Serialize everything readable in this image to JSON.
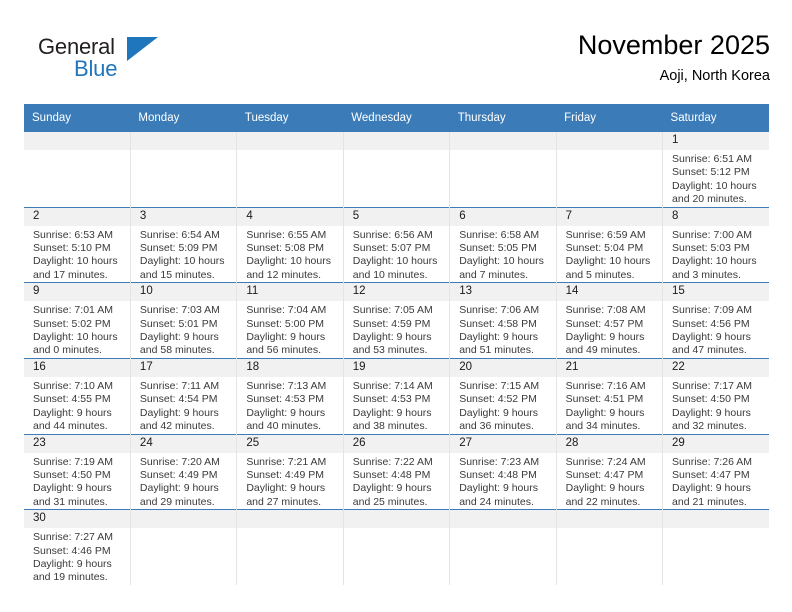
{
  "brand": {
    "name_top": "General",
    "name_bottom": "Blue",
    "accent_color": "#1f76bc",
    "flag_icon": "triangle-flag-icon"
  },
  "header": {
    "title": "November 2025",
    "subtitle": "Aoji, North Korea"
  },
  "theme": {
    "header_bg": "#3b7cb8",
    "daynum_bg": "#f1f1f1",
    "row_divider": "#3b7cb8",
    "col_divider": "#e4e4e4",
    "text": "#3a3a3a"
  },
  "weekdays": [
    "Sunday",
    "Monday",
    "Tuesday",
    "Wednesday",
    "Thursday",
    "Friday",
    "Saturday"
  ],
  "weeks": [
    [
      {
        "day": "",
        "sunrise": "",
        "sunset": "",
        "daylight_1": "",
        "daylight_2": ""
      },
      {
        "day": "",
        "sunrise": "",
        "sunset": "",
        "daylight_1": "",
        "daylight_2": ""
      },
      {
        "day": "",
        "sunrise": "",
        "sunset": "",
        "daylight_1": "",
        "daylight_2": ""
      },
      {
        "day": "",
        "sunrise": "",
        "sunset": "",
        "daylight_1": "",
        "daylight_2": ""
      },
      {
        "day": "",
        "sunrise": "",
        "sunset": "",
        "daylight_1": "",
        "daylight_2": ""
      },
      {
        "day": "",
        "sunrise": "",
        "sunset": "",
        "daylight_1": "",
        "daylight_2": ""
      },
      {
        "day": "1",
        "sunrise": "Sunrise: 6:51 AM",
        "sunset": "Sunset: 5:12 PM",
        "daylight_1": "Daylight: 10 hours",
        "daylight_2": "and 20 minutes."
      }
    ],
    [
      {
        "day": "2",
        "sunrise": "Sunrise: 6:53 AM",
        "sunset": "Sunset: 5:10 PM",
        "daylight_1": "Daylight: 10 hours",
        "daylight_2": "and 17 minutes."
      },
      {
        "day": "3",
        "sunrise": "Sunrise: 6:54 AM",
        "sunset": "Sunset: 5:09 PM",
        "daylight_1": "Daylight: 10 hours",
        "daylight_2": "and 15 minutes."
      },
      {
        "day": "4",
        "sunrise": "Sunrise: 6:55 AM",
        "sunset": "Sunset: 5:08 PM",
        "daylight_1": "Daylight: 10 hours",
        "daylight_2": "and 12 minutes."
      },
      {
        "day": "5",
        "sunrise": "Sunrise: 6:56 AM",
        "sunset": "Sunset: 5:07 PM",
        "daylight_1": "Daylight: 10 hours",
        "daylight_2": "and 10 minutes."
      },
      {
        "day": "6",
        "sunrise": "Sunrise: 6:58 AM",
        "sunset": "Sunset: 5:05 PM",
        "daylight_1": "Daylight: 10 hours",
        "daylight_2": "and 7 minutes."
      },
      {
        "day": "7",
        "sunrise": "Sunrise: 6:59 AM",
        "sunset": "Sunset: 5:04 PM",
        "daylight_1": "Daylight: 10 hours",
        "daylight_2": "and 5 minutes."
      },
      {
        "day": "8",
        "sunrise": "Sunrise: 7:00 AM",
        "sunset": "Sunset: 5:03 PM",
        "daylight_1": "Daylight: 10 hours",
        "daylight_2": "and 3 minutes."
      }
    ],
    [
      {
        "day": "9",
        "sunrise": "Sunrise: 7:01 AM",
        "sunset": "Sunset: 5:02 PM",
        "daylight_1": "Daylight: 10 hours",
        "daylight_2": "and 0 minutes."
      },
      {
        "day": "10",
        "sunrise": "Sunrise: 7:03 AM",
        "sunset": "Sunset: 5:01 PM",
        "daylight_1": "Daylight: 9 hours",
        "daylight_2": "and 58 minutes."
      },
      {
        "day": "11",
        "sunrise": "Sunrise: 7:04 AM",
        "sunset": "Sunset: 5:00 PM",
        "daylight_1": "Daylight: 9 hours",
        "daylight_2": "and 56 minutes."
      },
      {
        "day": "12",
        "sunrise": "Sunrise: 7:05 AM",
        "sunset": "Sunset: 4:59 PM",
        "daylight_1": "Daylight: 9 hours",
        "daylight_2": "and 53 minutes."
      },
      {
        "day": "13",
        "sunrise": "Sunrise: 7:06 AM",
        "sunset": "Sunset: 4:58 PM",
        "daylight_1": "Daylight: 9 hours",
        "daylight_2": "and 51 minutes."
      },
      {
        "day": "14",
        "sunrise": "Sunrise: 7:08 AM",
        "sunset": "Sunset: 4:57 PM",
        "daylight_1": "Daylight: 9 hours",
        "daylight_2": "and 49 minutes."
      },
      {
        "day": "15",
        "sunrise": "Sunrise: 7:09 AM",
        "sunset": "Sunset: 4:56 PM",
        "daylight_1": "Daylight: 9 hours",
        "daylight_2": "and 47 minutes."
      }
    ],
    [
      {
        "day": "16",
        "sunrise": "Sunrise: 7:10 AM",
        "sunset": "Sunset: 4:55 PM",
        "daylight_1": "Daylight: 9 hours",
        "daylight_2": "and 44 minutes."
      },
      {
        "day": "17",
        "sunrise": "Sunrise: 7:11 AM",
        "sunset": "Sunset: 4:54 PM",
        "daylight_1": "Daylight: 9 hours",
        "daylight_2": "and 42 minutes."
      },
      {
        "day": "18",
        "sunrise": "Sunrise: 7:13 AM",
        "sunset": "Sunset: 4:53 PM",
        "daylight_1": "Daylight: 9 hours",
        "daylight_2": "and 40 minutes."
      },
      {
        "day": "19",
        "sunrise": "Sunrise: 7:14 AM",
        "sunset": "Sunset: 4:53 PM",
        "daylight_1": "Daylight: 9 hours",
        "daylight_2": "and 38 minutes."
      },
      {
        "day": "20",
        "sunrise": "Sunrise: 7:15 AM",
        "sunset": "Sunset: 4:52 PM",
        "daylight_1": "Daylight: 9 hours",
        "daylight_2": "and 36 minutes."
      },
      {
        "day": "21",
        "sunrise": "Sunrise: 7:16 AM",
        "sunset": "Sunset: 4:51 PM",
        "daylight_1": "Daylight: 9 hours",
        "daylight_2": "and 34 minutes."
      },
      {
        "day": "22",
        "sunrise": "Sunrise: 7:17 AM",
        "sunset": "Sunset: 4:50 PM",
        "daylight_1": "Daylight: 9 hours",
        "daylight_2": "and 32 minutes."
      }
    ],
    [
      {
        "day": "23",
        "sunrise": "Sunrise: 7:19 AM",
        "sunset": "Sunset: 4:50 PM",
        "daylight_1": "Daylight: 9 hours",
        "daylight_2": "and 31 minutes."
      },
      {
        "day": "24",
        "sunrise": "Sunrise: 7:20 AM",
        "sunset": "Sunset: 4:49 PM",
        "daylight_1": "Daylight: 9 hours",
        "daylight_2": "and 29 minutes."
      },
      {
        "day": "25",
        "sunrise": "Sunrise: 7:21 AM",
        "sunset": "Sunset: 4:49 PM",
        "daylight_1": "Daylight: 9 hours",
        "daylight_2": "and 27 minutes."
      },
      {
        "day": "26",
        "sunrise": "Sunrise: 7:22 AM",
        "sunset": "Sunset: 4:48 PM",
        "daylight_1": "Daylight: 9 hours",
        "daylight_2": "and 25 minutes."
      },
      {
        "day": "27",
        "sunrise": "Sunrise: 7:23 AM",
        "sunset": "Sunset: 4:48 PM",
        "daylight_1": "Daylight: 9 hours",
        "daylight_2": "and 24 minutes."
      },
      {
        "day": "28",
        "sunrise": "Sunrise: 7:24 AM",
        "sunset": "Sunset: 4:47 PM",
        "daylight_1": "Daylight: 9 hours",
        "daylight_2": "and 22 minutes."
      },
      {
        "day": "29",
        "sunrise": "Sunrise: 7:26 AM",
        "sunset": "Sunset: 4:47 PM",
        "daylight_1": "Daylight: 9 hours",
        "daylight_2": "and 21 minutes."
      }
    ],
    [
      {
        "day": "30",
        "sunrise": "Sunrise: 7:27 AM",
        "sunset": "Sunset: 4:46 PM",
        "daylight_1": "Daylight: 9 hours",
        "daylight_2": "and 19 minutes."
      },
      {
        "day": "",
        "sunrise": "",
        "sunset": "",
        "daylight_1": "",
        "daylight_2": ""
      },
      {
        "day": "",
        "sunrise": "",
        "sunset": "",
        "daylight_1": "",
        "daylight_2": ""
      },
      {
        "day": "",
        "sunrise": "",
        "sunset": "",
        "daylight_1": "",
        "daylight_2": ""
      },
      {
        "day": "",
        "sunrise": "",
        "sunset": "",
        "daylight_1": "",
        "daylight_2": ""
      },
      {
        "day": "",
        "sunrise": "",
        "sunset": "",
        "daylight_1": "",
        "daylight_2": ""
      },
      {
        "day": "",
        "sunrise": "",
        "sunset": "",
        "daylight_1": "",
        "daylight_2": ""
      }
    ]
  ]
}
